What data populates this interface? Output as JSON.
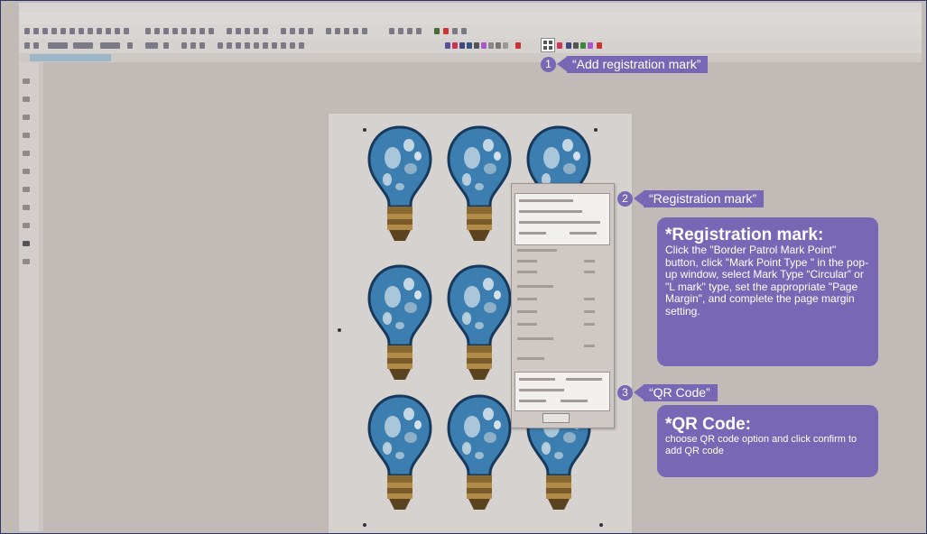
{
  "steps": [
    {
      "num": "1",
      "label": "“Add registration mark”"
    },
    {
      "num": "2",
      "label": "“Registration mark”"
    },
    {
      "num": "3",
      "label": "“QR Code”"
    }
  ],
  "info_boxes": [
    {
      "title": "*Registration mark:",
      "body": "Click the \"Border Patrol Mark Point\" button, click \"Mark Point Type \" in the pop-up window, select Mark Type “Circular” or \"L mark\" type, set the appropriate \"Page Margin\", and complete the page margin setting."
    },
    {
      "title": "*QR Code:",
      "body": "choose QR code option and click confirm to add QR code"
    }
  ],
  "colors": {
    "accent": "#7767b5",
    "canvas": "#c2bab7",
    "frame_border": "#2c3566",
    "bulb_blue": "#3d7eb0",
    "bulb_base": "#9b7a3c"
  },
  "icons": {
    "registration_mark_button": "registration-mark-icon",
    "bulb_image": "lightbulb-image"
  }
}
